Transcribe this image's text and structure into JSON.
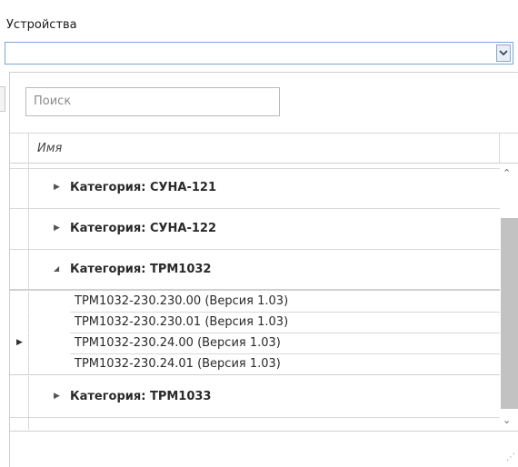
{
  "field": {
    "label": "Устройства",
    "value": ""
  },
  "search": {
    "placeholder": "Поиск"
  },
  "grid": {
    "column_name": "Имя",
    "groups": [
      {
        "label": "Категория: СУНА-121",
        "expanded": false
      },
      {
        "label": "Категория: СУНА-122",
        "expanded": false
      },
      {
        "label": "Категория: ТРМ1032",
        "expanded": true
      },
      {
        "label": "Категория: ТРМ1033",
        "expanded": false
      }
    ],
    "items": [
      "ТРМ1032-230.230.00 (Версия 1.03)",
      "ТРМ1032-230.230.01 (Версия 1.03)",
      "ТРМ1032-230.24.00 (Версия 1.03)",
      "ТРМ1032-230.24.01 (Версия 1.03)"
    ]
  },
  "icons": {
    "dropdown": "chevron-down-icon",
    "collapsed": "triangle-right-icon",
    "expanded": "triangle-down-right-icon",
    "row_indicator": "row-pointer-icon",
    "scroll_up": "scroll-up-icon",
    "scroll_down": "scroll-down-icon",
    "resize": "resize-grip-icon"
  }
}
